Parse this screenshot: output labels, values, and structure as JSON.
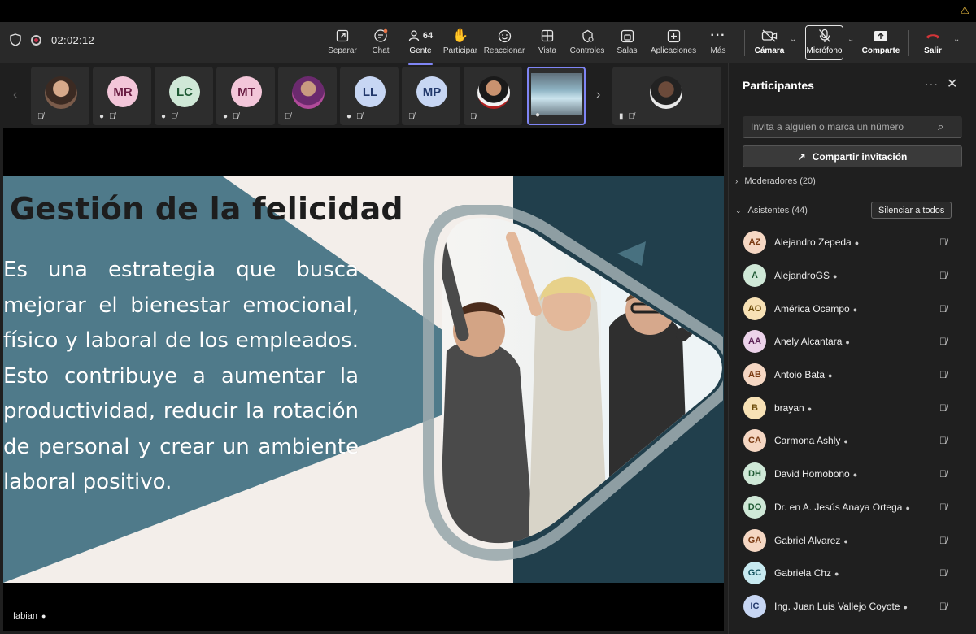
{
  "toolbar": {
    "timer": "02:02:12",
    "buttons": [
      {
        "label": "Separar",
        "icon": "pop-out-icon"
      },
      {
        "label": "Chat",
        "icon": "chat-icon"
      },
      {
        "label": "Gente",
        "icon": "people-icon",
        "count": "64"
      },
      {
        "label": "Participar",
        "icon": "raise-hand-icon"
      },
      {
        "label": "Reaccionar",
        "icon": "smiley-icon"
      },
      {
        "label": "Vista",
        "icon": "view-grid-icon"
      },
      {
        "label": "Controles",
        "icon": "controls-icon"
      },
      {
        "label": "Salas",
        "icon": "breakout-rooms-icon"
      },
      {
        "label": "Aplicaciones",
        "icon": "add-apps-icon"
      },
      {
        "label": "Más",
        "icon": "more-icon"
      }
    ],
    "camera_label": "Cámara",
    "mic_label": "Micrófono",
    "share_label": "Comparte",
    "leave_label": "Salir",
    "leave_color": "#d13438",
    "accent": "#7f85f5"
  },
  "strip": {
    "tiles": [
      {
        "type": "photo"
      },
      {
        "type": "initials",
        "initials": "MR",
        "bg": "#f3c6d9",
        "fg": "#6b1e44"
      },
      {
        "type": "initials",
        "initials": "LC",
        "bg": "#cfe8d7",
        "fg": "#1f5a34"
      },
      {
        "type": "initials",
        "initials": "MT",
        "bg": "#f3c6d9",
        "fg": "#6b1e44"
      },
      {
        "type": "photo"
      },
      {
        "type": "initials",
        "initials": "LL",
        "bg": "#c7d6f3",
        "fg": "#22386b"
      },
      {
        "type": "initials",
        "initials": "MP",
        "bg": "#c7d6f3",
        "fg": "#22386b"
      },
      {
        "type": "photo"
      },
      {
        "type": "screen"
      },
      {
        "type": "photo"
      }
    ]
  },
  "slide": {
    "title": "Gestión de la felicidad",
    "body": "Es una estrategia que busca mejorar el bienestar emocional, físico y laboral de los empleados. Esto contribuye a aumentar la productividad, reducir la rotación de personal y crear un ambiente laboral positivo.",
    "blue": "#4f7a8a",
    "dark_panel": "#213f4c"
  },
  "stage": {
    "presenter_name": "fabian"
  },
  "sidebar": {
    "title": "Participantes",
    "search_placeholder": "Invita a alguien o marca un número",
    "invite_label": "Compartir invitación",
    "moderators_label": "Moderadores (20)",
    "attendees_label": "Asistentes (44)",
    "mute_all_label": "Silenciar a todos",
    "participants": [
      {
        "initials": "AZ",
        "name": "Alejandro Zepeda",
        "bg": "#f5d7c3",
        "fg": "#7a3a12"
      },
      {
        "initials": "A",
        "name": "AlejandroGS",
        "bg": "#cfe8d7",
        "fg": "#1f5a34"
      },
      {
        "initials": "AO",
        "name": "América Ocampo",
        "bg": "#f7e1b5",
        "fg": "#6b4a08"
      },
      {
        "initials": "AA",
        "name": "Anely Alcantara",
        "bg": "#ecd3ea",
        "fg": "#5c2257"
      },
      {
        "initials": "AB",
        "name": "Antoio Bata",
        "bg": "#f5d7c3",
        "fg": "#7a3a12"
      },
      {
        "initials": "B",
        "name": "brayan",
        "bg": "#f7e1b5",
        "fg": "#6b4a08"
      },
      {
        "initials": "CA",
        "name": "Carmona Ashly",
        "bg": "#f5d7c3",
        "fg": "#7a3a12"
      },
      {
        "initials": "DH",
        "name": "David Homobono",
        "bg": "#cfe8d7",
        "fg": "#1f5a34"
      },
      {
        "initials": "DO",
        "name": "Dr. en A. Jesús Anaya Ortega",
        "bg": "#cfe8d7",
        "fg": "#1f5a34"
      },
      {
        "initials": "GA",
        "name": "Gabriel Alvarez",
        "bg": "#f5d7c3",
        "fg": "#7a3a12"
      },
      {
        "initials": "GC",
        "name": "Gabriela Chz",
        "bg": "#c7e9f0",
        "fg": "#14525e"
      },
      {
        "initials": "IC",
        "name": "Ing. Juan Luis Vallejo Coyote",
        "bg": "#c7d6f3",
        "fg": "#22386b"
      }
    ]
  }
}
